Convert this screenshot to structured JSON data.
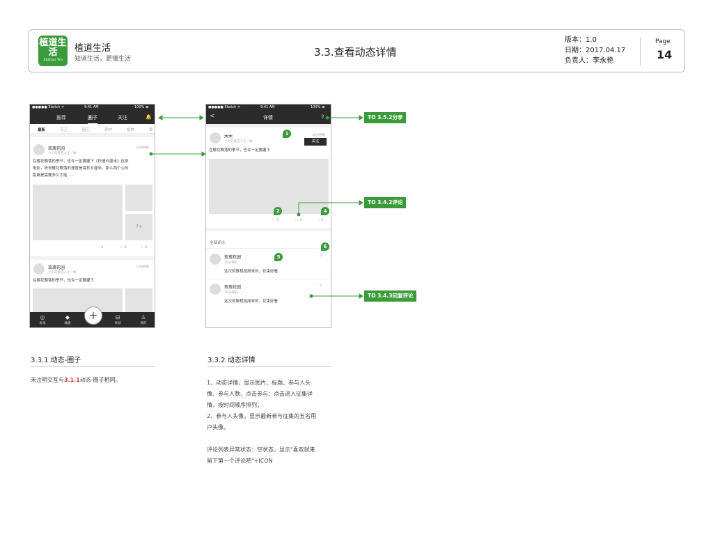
{
  "header": {
    "logo_text": "植道生活",
    "logo_sub": "ZhiDao Wo",
    "app_name": "植道生活",
    "slogan": "知道生活，更懂生活",
    "doc_title": "3.3.查看动态详情",
    "version": "版本：1.0",
    "date": "日期：2017.04.17",
    "owner": "负责人：李永艳",
    "page_label": "Page",
    "page_number": "14"
  },
  "phone1": {
    "status": {
      "carrier": "●●●●● Sketch ᯤ",
      "time": "9:41 AM",
      "battery": "100% ▬"
    },
    "nav": {
      "tab_recommend": "推荐",
      "tab_circle": "圈子",
      "tab_follow": "关注",
      "bell": "🔔"
    },
    "categories": [
      "最新",
      "花艺",
      "园艺",
      "养护",
      "植物",
      "家居"
    ],
    "post1": {
      "name": "玫瑰花园",
      "time": "10分钟前",
      "subtitle": "小小的爱花人士一枚",
      "line1": "在樱花飘落的季节，也许一定要握下《秒速五厘米》这部",
      "line2": "电影，听说樱花飘落的速度是每秒五厘米。那么两个心的",
      "line3": "距离是需要多久才能……",
      "more": "7+",
      "likes": "5",
      "comments": "0",
      "stars": "2"
    },
    "post2": {
      "name": "玫瑰花园",
      "time": "10分钟前",
      "subtitle": "小小的爱花人士一枚",
      "text": "在樱花飘落的季节，也许一定要握下"
    },
    "tabbar": [
      "发现",
      "动态",
      "商城",
      "我的"
    ],
    "plus": "+"
  },
  "phone2": {
    "status": {
      "carrier": "●●●●● Sketch ᯤ",
      "time": "9:41 AM",
      "battery": "100% ▬"
    },
    "nav": {
      "back": "<",
      "title": "详情",
      "share": "⇪"
    },
    "post": {
      "name": "木木",
      "time": "10分钟前",
      "subtitle": "小小的爱花人士一枚",
      "follow": "关注",
      "text": "在樱花飘落的季节，也许一定要握下",
      "likes": "5",
      "comments": "0",
      "stars": "2"
    },
    "comments_title": "全部评论",
    "comments": [
      {
        "name": "玫瑰花园",
        "time": "10分钟前",
        "text": "这次的教程挺简单的，花束好看",
        "likes": "2"
      },
      {
        "name": "玫瑰花园",
        "time": "10分钟前",
        "text": "这次的教程挺简单的，花束好看",
        "likes": "2"
      }
    ]
  },
  "badges": [
    "1",
    "2",
    "4",
    "5",
    "6"
  ],
  "links": {
    "share": "TO 3.5.2分享",
    "comment": "TO 3.4.2评论",
    "reply": "TO 3.4.3回复评论"
  },
  "section1": {
    "title": "3.3.1 动态-圈子",
    "desc_pre": "未注明交互与",
    "desc_ref": "3.1.1",
    "desc_post": "动态-圈子相同。"
  },
  "section2": {
    "title": "3.3.2 动态详情",
    "lines": [
      "1、动态详情，显示图片、标题、参与人头",
      "像、参与人数、点击参与：点击进入征集详",
      "情，按时间顺序排列；",
      "2、参与人头像，显示最新参与征集的五名用",
      "户头像。",
      "",
      "评论列表异常状态：空状态，显示\"喜欢就来",
      "留下第一个评论吧\"+ICON"
    ]
  },
  "colors": {
    "accent": "#3a9b3a",
    "dark": "#2b2b2b",
    "highlight": "#c0392b"
  }
}
